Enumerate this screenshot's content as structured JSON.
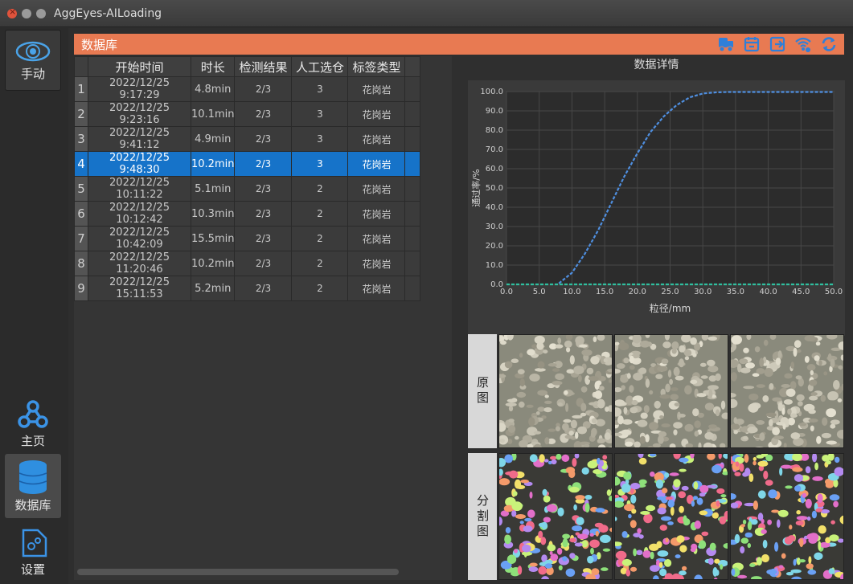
{
  "window": {
    "title": "AggEyes-AILoading"
  },
  "sidebar": {
    "manual_label": "手动",
    "home_label": "主页",
    "db_label": "数据库",
    "settings_label": "设置"
  },
  "header": {
    "title": "数据库",
    "icons": [
      "truck-icon",
      "calendar-icon",
      "exit-icon",
      "wifi-icon",
      "refresh-icon"
    ],
    "icon_color": "#2f7fd8"
  },
  "table": {
    "columns": [
      "开始时间",
      "时长",
      "检测结果",
      "人工选仓",
      "标签类型"
    ],
    "selected_row": 3,
    "rows": [
      [
        "2022/12/25 9:17:29",
        "4.8min",
        "2/3",
        "3",
        "花岗岩"
      ],
      [
        "2022/12/25 9:23:16",
        "10.1min",
        "2/3",
        "3",
        "花岗岩"
      ],
      [
        "2022/12/25 9:41:12",
        "4.9min",
        "2/3",
        "3",
        "花岗岩"
      ],
      [
        "2022/12/25 9:48:30",
        "10.2min",
        "2/3",
        "3",
        "花岗岩"
      ],
      [
        "2022/12/25 10:11:22",
        "5.1min",
        "2/3",
        "2",
        "花岗岩"
      ],
      [
        "2022/12/25 10:12:42",
        "10.3min",
        "2/3",
        "2",
        "花岗岩"
      ],
      [
        "2022/12/25 10:42:09",
        "15.5min",
        "2/3",
        "2",
        "花岗岩"
      ],
      [
        "2022/12/25 11:20:46",
        "10.2min",
        "2/3",
        "2",
        "花岗岩"
      ],
      [
        "2022/12/25 15:11:53",
        "5.2min",
        "2/3",
        "2",
        "花岗岩"
      ]
    ]
  },
  "detail": {
    "title": "数据详情",
    "original_label": "原图",
    "segment_label": "分割图"
  },
  "chart_data": {
    "type": "line",
    "xlabel": "粒径/mm",
    "ylabel": "通过率/%",
    "xlim": [
      0,
      50
    ],
    "ylim": [
      0,
      100
    ],
    "xticks": [
      "0.0",
      "5.0",
      "10.0",
      "15.0",
      "20.0",
      "25.0",
      "30.0",
      "35.0",
      "40.0",
      "45.0",
      "50.0"
    ],
    "yticks": [
      "0.0",
      "10.0",
      "20.0",
      "30.0",
      "40.0",
      "50.0",
      "60.0",
      "70.0",
      "80.0",
      "90.0",
      "100.0"
    ],
    "grid": true,
    "series": [
      {
        "color": "#4f8fe0",
        "x": [
          8,
          10,
          12,
          14,
          16,
          18,
          20,
          22,
          24,
          26,
          28,
          30,
          32,
          34,
          40,
          50
        ],
        "y": [
          0.5,
          6,
          16,
          28,
          42,
          56,
          68,
          79,
          87,
          93,
          97,
          99,
          99.6,
          99.8,
          99.8,
          99.8
        ]
      },
      {
        "color": "#2fbf9f",
        "x": [
          0,
          50
        ],
        "y": [
          0,
          0
        ]
      }
    ]
  }
}
